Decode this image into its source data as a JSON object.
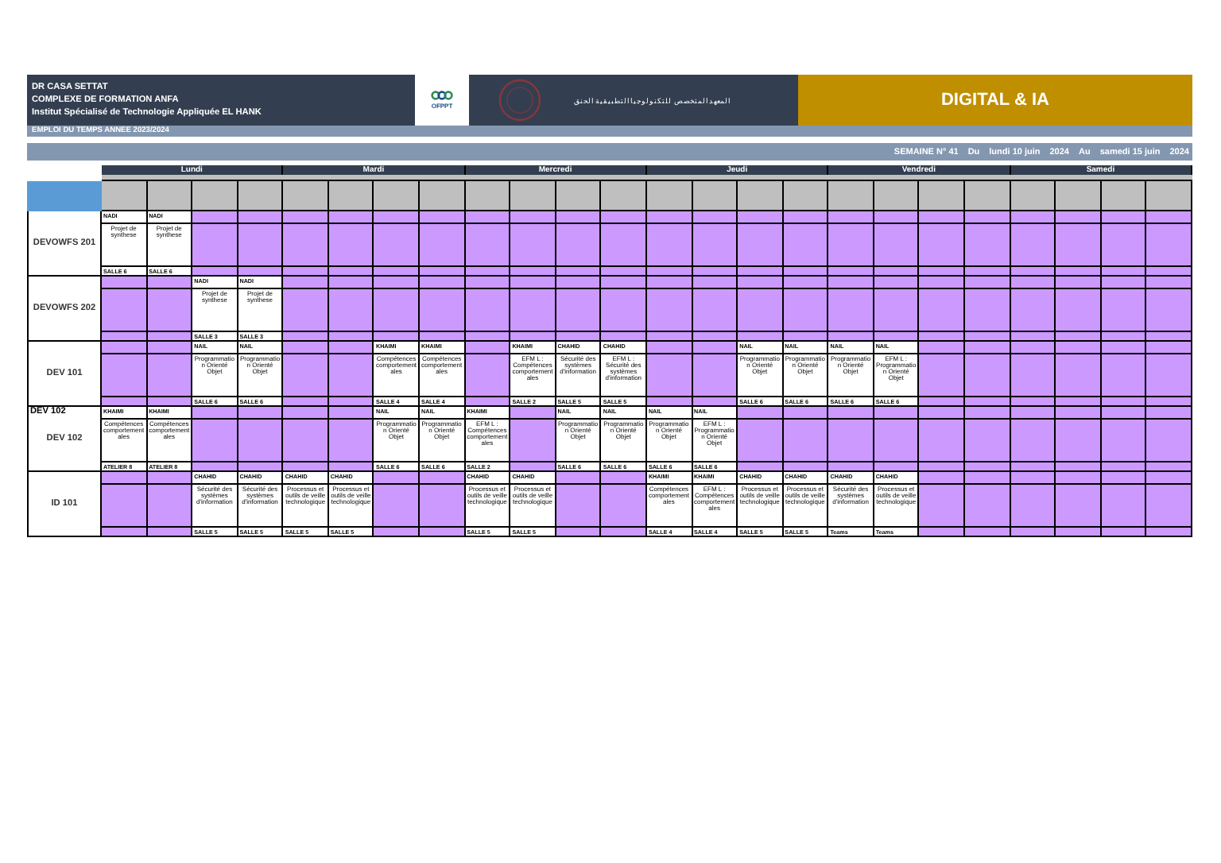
{
  "banner": {
    "lines": [
      "DR CASA SETTAT",
      "COMPLEXE DE FORMATION ANFA",
      "Institut Spécialisé de Technologie Appliquée EL HANK"
    ],
    "logo_text": "OFPPT",
    "arabic_title": "المعهد المتخصص للتكنولوجيا التطبيقية الحنق",
    "department": "DIGITAL & IA"
  },
  "subtitle": "EMPLOI DU TEMPS ANNEE 2023/2024",
  "week": [
    "SEMAINE N° 41",
    "Du",
    "lundi 10 juin",
    "2024",
    "Au",
    "samedi 15 juin",
    "2024"
  ],
  "days": [
    {
      "label": "Lundi"
    },
    {
      "label": "Mardi"
    },
    {
      "label": "Mercredi"
    },
    {
      "label": "Jeudi"
    },
    {
      "label": "Vendredi"
    },
    {
      "label": "Samedi"
    }
  ],
  "groups": [
    {
      "name": "DEVOWFS 201",
      "slots": [
        {
          "kind": "session",
          "teacher": "NADI",
          "subject": "Projet de synthese",
          "room": "SALLE 6"
        },
        {
          "kind": "session",
          "teacher": "NADI",
          "subject": "Projet de synthese",
          "room": "SALLE 6"
        },
        {
          "kind": "free"
        },
        {
          "kind": "free"
        },
        {
          "kind": "free"
        },
        {
          "kind": "free"
        },
        {
          "kind": "free"
        },
        {
          "kind": "free"
        },
        {
          "kind": "free"
        },
        {
          "kind": "free"
        },
        {
          "kind": "free"
        },
        {
          "kind": "free"
        },
        {
          "kind": "free"
        },
        {
          "kind": "free"
        },
        {
          "kind": "free"
        },
        {
          "kind": "free"
        },
        {
          "kind": "free"
        },
        {
          "kind": "free"
        },
        {
          "kind": "free"
        },
        {
          "kind": "free"
        },
        {
          "kind": "free"
        },
        {
          "kind": "free"
        },
        {
          "kind": "free"
        },
        {
          "kind": "free"
        }
      ]
    },
    {
      "name": "DEVOWFS 202",
      "slots": [
        {
          "kind": "free"
        },
        {
          "kind": "free"
        },
        {
          "kind": "session",
          "teacher": "NADI",
          "subject": "Projet de synthese",
          "room": "SALLE 3"
        },
        {
          "kind": "session",
          "teacher": "NADI",
          "subject": "Projet de synthese",
          "room": "SALLE 3"
        },
        {
          "kind": "free"
        },
        {
          "kind": "free"
        },
        {
          "kind": "free"
        },
        {
          "kind": "free"
        },
        {
          "kind": "free"
        },
        {
          "kind": "free"
        },
        {
          "kind": "free"
        },
        {
          "kind": "free"
        },
        {
          "kind": "free"
        },
        {
          "kind": "free"
        },
        {
          "kind": "free"
        },
        {
          "kind": "free"
        },
        {
          "kind": "free"
        },
        {
          "kind": "free"
        },
        {
          "kind": "free"
        },
        {
          "kind": "free"
        },
        {
          "kind": "free"
        },
        {
          "kind": "free"
        },
        {
          "kind": "free"
        },
        {
          "kind": "free"
        }
      ]
    },
    {
      "name": "DEV 101",
      "slots": [
        {
          "kind": "free"
        },
        {
          "kind": "free"
        },
        {
          "kind": "session",
          "teacher": "NAIL",
          "subject": "Programmation Orienté Objet",
          "room": "SALLE 6"
        },
        {
          "kind": "session",
          "teacher": "NAIL",
          "subject": "Programmation Orienté Objet",
          "room": "SALLE 6"
        },
        {
          "kind": "free"
        },
        {
          "kind": "free"
        },
        {
          "kind": "session",
          "teacher": "KHAIMI",
          "subject": "Compétences comportementales",
          "room": "SALLE 4"
        },
        {
          "kind": "session",
          "teacher": "KHAIMI",
          "subject": "Compétences comportementales",
          "room": "SALLE 4"
        },
        {
          "kind": "free"
        },
        {
          "kind": "session",
          "teacher": "KHAIMI",
          "subject": "EFM L : Compétences comportementales",
          "room": "SALLE 2"
        },
        {
          "kind": "session",
          "teacher": "CHAHID",
          "subject": "Sécurité des systèmes d'information",
          "room": "SALLE 5"
        },
        {
          "kind": "session",
          "teacher": "CHAHID",
          "subject": "EFM L : Sécurité des systèmes d'information",
          "room": "SALLE 5"
        },
        {
          "kind": "free"
        },
        {
          "kind": "free"
        },
        {
          "kind": "session",
          "teacher": "NAIL",
          "subject": "Programmation Orienté Objet",
          "room": "SALLE 6"
        },
        {
          "kind": "session",
          "teacher": "NAIL",
          "subject": "Programmation Orienté Objet",
          "room": "SALLE 6"
        },
        {
          "kind": "session",
          "teacher": "NAIL",
          "subject": "Programmation Orienté Objet",
          "room": "SALLE 6"
        },
        {
          "kind": "session",
          "teacher": "NAIL",
          "subject": "EFM L : Programmation Orienté Objet",
          "room": "SALLE 6"
        },
        {
          "kind": "free"
        },
        {
          "kind": "free"
        },
        {
          "kind": "free"
        },
        {
          "kind": "free"
        },
        {
          "kind": "free"
        },
        {
          "kind": "free"
        }
      ]
    },
    {
      "name": "DEV 102",
      "corner_label": "DEV 102",
      "slots": [
        {
          "kind": "session",
          "teacher": "KHAIMI",
          "subject": "Compétences comportementales",
          "room": "ATELIER 8"
        },
        {
          "kind": "session",
          "teacher": "KHAIMI",
          "subject": "Compétences comportementales",
          "room": "ATELIER 8"
        },
        {
          "kind": "free"
        },
        {
          "kind": "free"
        },
        {
          "kind": "free"
        },
        {
          "kind": "free"
        },
        {
          "kind": "session",
          "teacher": "NAIL",
          "subject": "Programmation Orienté Objet",
          "room": "SALLE 6"
        },
        {
          "kind": "session",
          "teacher": "NAIL",
          "subject": "Programmation Orienté Objet",
          "room": "SALLE 6"
        },
        {
          "kind": "session",
          "teacher": "KHAIMI",
          "subject": "EFM L : Compétences comportementales",
          "room": "SALLE 2"
        },
        {
          "kind": "free"
        },
        {
          "kind": "session",
          "teacher": "NAIL",
          "subject": "Programmation Orienté Objet",
          "room": "SALLE 6"
        },
        {
          "kind": "session",
          "teacher": "NAIL",
          "subject": "Programmation Orienté Objet",
          "room": "SALLE 6"
        },
        {
          "kind": "session",
          "teacher": "NAIL",
          "subject": "Programmation Orienté Objet",
          "room": "SALLE 6"
        },
        {
          "kind": "session",
          "teacher": "NAIL",
          "subject": "EFM L : Programmation Orienté Objet",
          "room": "SALLE 6"
        },
        {
          "kind": "free"
        },
        {
          "kind": "free"
        },
        {
          "kind": "free"
        },
        {
          "kind": "free"
        },
        {
          "kind": "free"
        },
        {
          "kind": "free"
        },
        {
          "kind": "free"
        },
        {
          "kind": "free"
        },
        {
          "kind": "free"
        },
        {
          "kind": "free"
        }
      ]
    },
    {
      "name": "ID 101",
      "slots": [
        {
          "kind": "free"
        },
        {
          "kind": "free"
        },
        {
          "kind": "session",
          "teacher": "CHAHID",
          "subject": "Sécurité des systèmes d'information",
          "room": "SALLE 5"
        },
        {
          "kind": "session",
          "teacher": "CHAHID",
          "subject": "Sécurité des systèmes d'information",
          "room": "SALLE 5"
        },
        {
          "kind": "session",
          "teacher": "CHAHID",
          "subject": "Processus et outils de veille technologique",
          "room": "SALLE 5"
        },
        {
          "kind": "session",
          "teacher": "CHAHID",
          "subject": "Processus et outils de veille technologique",
          "room": "SALLE 5"
        },
        {
          "kind": "free"
        },
        {
          "kind": "free"
        },
        {
          "kind": "session",
          "teacher": "CHAHID",
          "subject": "Processus et outils de veille technologique",
          "room": "SALLE 5"
        },
        {
          "kind": "session",
          "teacher": "CHAHID",
          "subject": "Processus et outils de veille technologique",
          "room": "SALLE 5"
        },
        {
          "kind": "free"
        },
        {
          "kind": "free"
        },
        {
          "kind": "session",
          "teacher": "KHAIMI",
          "subject": "Compétences comportementales",
          "room": "SALLE 4"
        },
        {
          "kind": "session",
          "teacher": "KHAIMI",
          "subject": "EFM L : Compétences comportementales",
          "room": "SALLE 4"
        },
        {
          "kind": "session",
          "teacher": "CHAHID",
          "subject": "Processus et outils de veille technologique",
          "room": "SALLE 5"
        },
        {
          "kind": "session",
          "teacher": "CHAHID",
          "subject": "Processus et outils de veille technologique",
          "room": "SALLE 5"
        },
        {
          "kind": "session",
          "teacher": "CHAHID",
          "subject": "Sécurité des systèmes d'information",
          "room": "Teams"
        },
        {
          "kind": "session",
          "teacher": "CHAHID",
          "subject": "Processus et outils de veille technologique",
          "room": "Teams"
        },
        {
          "kind": "free"
        },
        {
          "kind": "free"
        },
        {
          "kind": "free"
        },
        {
          "kind": "free"
        },
        {
          "kind": "free"
        },
        {
          "kind": "free"
        }
      ]
    }
  ]
}
